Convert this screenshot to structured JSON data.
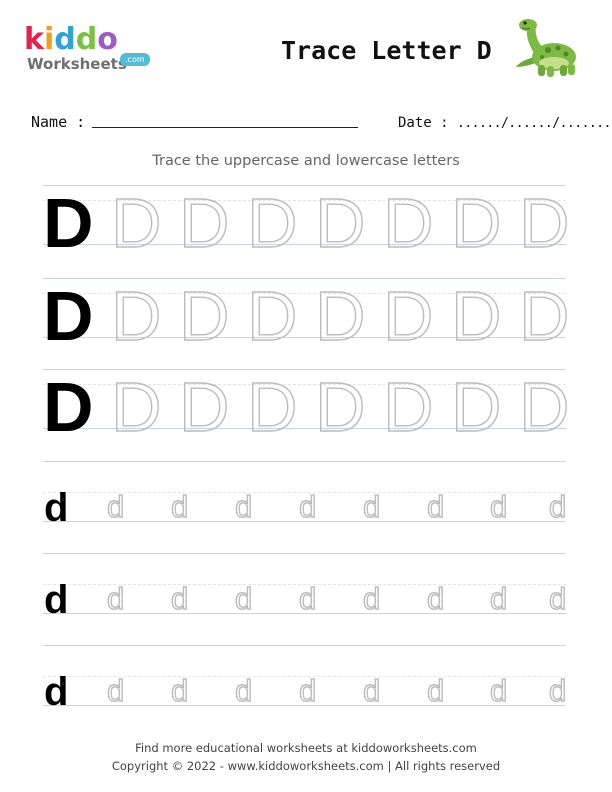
{
  "header": {
    "logo_letters": [
      "k",
      "i",
      "d",
      "d",
      "o"
    ],
    "logo_colors": [
      "#e3224f",
      "#f39c1e",
      "#2fa3d8",
      "#7ac143",
      "#9b5cc6"
    ],
    "logo_subtitle": "Worksheets",
    "logo_domain": ".com",
    "title": "Trace Letter D",
    "mascot": "dinosaur-icon"
  },
  "form": {
    "name_label": "Name :",
    "date_label": "Date :",
    "date_blank": "....../....../..........."
  },
  "instruction": "Trace the uppercase and lowercase letters",
  "uppercase": {
    "model": "D",
    "trace": [
      "D",
      "D",
      "D",
      "D",
      "D",
      "D",
      "D"
    ]
  },
  "lowercase": {
    "model": "d",
    "trace": [
      "d",
      "d",
      "d",
      "d",
      "d",
      "d",
      "d",
      "d"
    ]
  },
  "footer": {
    "line1": "Find more educational worksheets at kiddoworksheets.com",
    "line2": "Copyright © 2022 - www.kiddoworksheets.com  |  All rights reserved"
  }
}
